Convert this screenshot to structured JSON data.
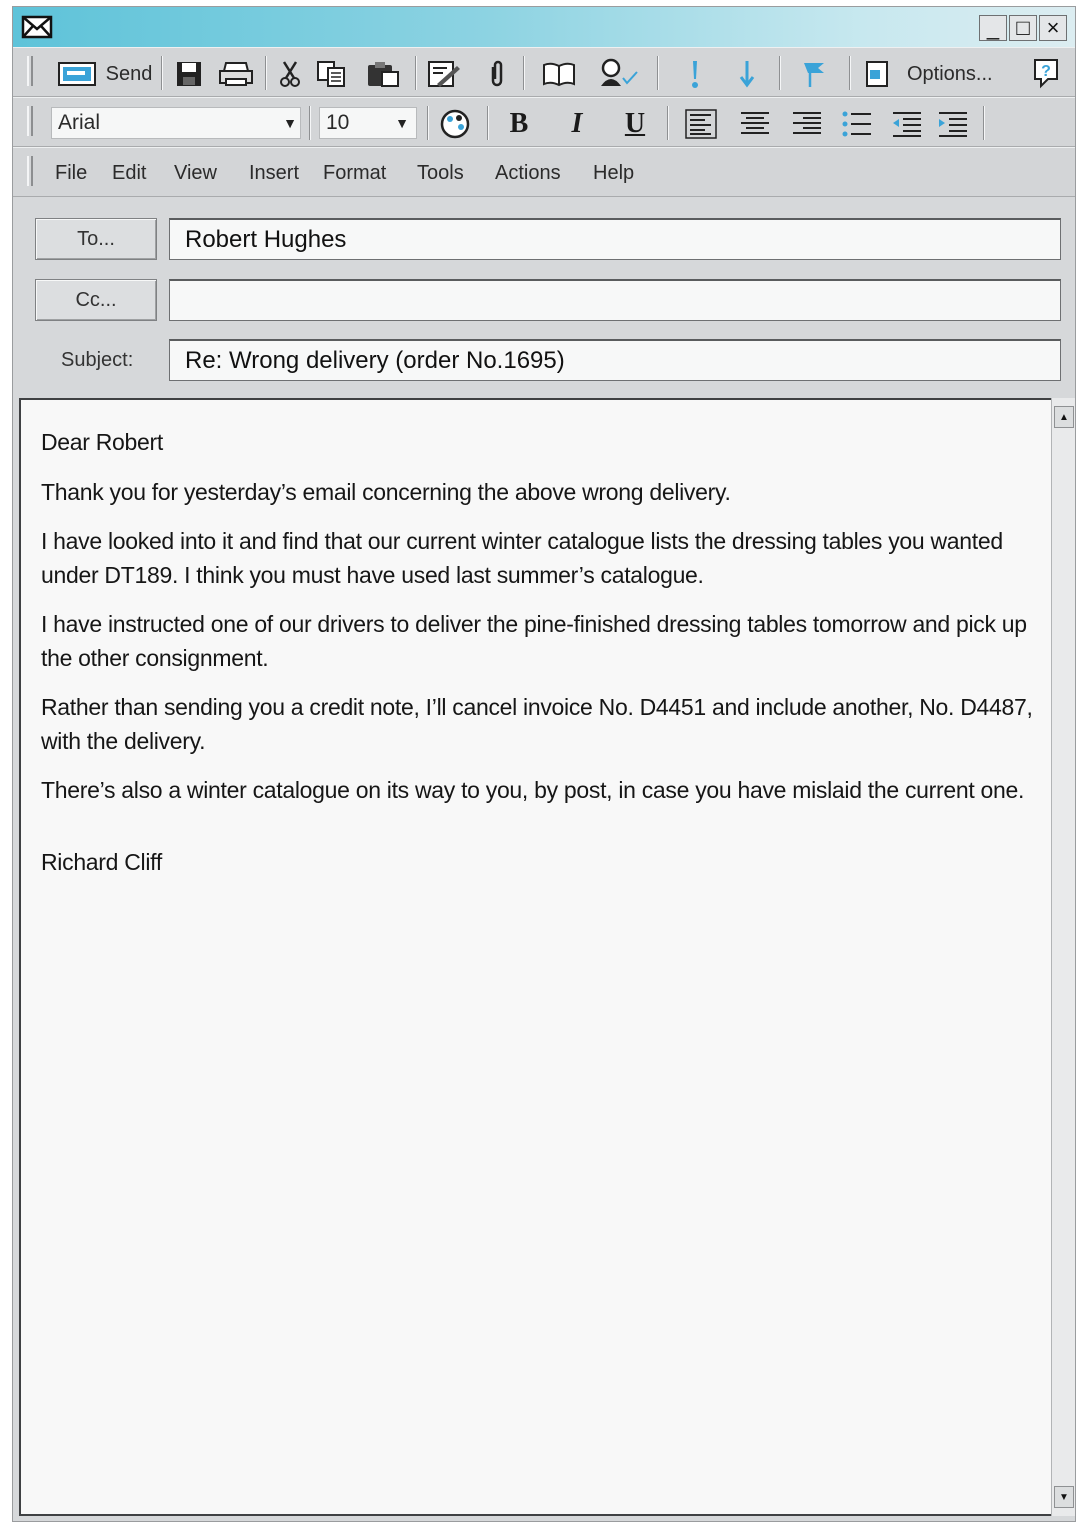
{
  "titlebar": {
    "icon": "envelope-icon",
    "minimize_label": "_",
    "maximize_label": "□",
    "close_label": "×"
  },
  "standard_toolbar": {
    "send_label": "Send",
    "options_label": "Options...",
    "icons": [
      "send-icon",
      "save-icon",
      "print-icon",
      "cut-icon",
      "copy-icon",
      "paste-icon",
      "signature-icon",
      "attach-icon",
      "address-book-icon",
      "check-names-icon",
      "importance-high-icon",
      "importance-low-icon",
      "flag-icon",
      "options-icon",
      "help-icon"
    ]
  },
  "format_toolbar": {
    "font_name": "Arial",
    "font_size": "10",
    "bold_label": "B",
    "italic_label": "I",
    "underline_label": "U"
  },
  "menu": {
    "items": [
      "File",
      "Edit",
      "View",
      "Insert",
      "Format",
      "Tools",
      "Actions",
      "Help"
    ]
  },
  "header": {
    "to_button": "To...",
    "to_value": "Robert Hughes",
    "cc_button": "Cc...",
    "cc_value": "",
    "subject_label": "Subject:",
    "subject_value": "Re: Wrong delivery (order No.1695)"
  },
  "message": {
    "greeting": "Dear Robert",
    "paragraphs": [
      "Thank you for yesterday’s email concerning the above wrong delivery.",
      "I have looked into it and find that our current winter catalogue lists the dressing tables you wanted under DT189. I think you must have used last summer’s catalogue.",
      "I have instructed one of our drivers to deliver the pine-finished dressing tables tomorrow and pick up the other consignment.",
      "Rather than sending you a credit note, I’ll cancel invoice No. D4451 and include another, No. D4487, with the delivery.",
      "There’s also a winter catalogue on its way to you, by post, in case you have mislaid the current one."
    ],
    "signature": "Richard Cliff"
  },
  "colors": {
    "titlebar_start": "#5ec3d9",
    "titlebar_end": "#dcedf1",
    "chrome": "#d6d8da",
    "accent_blue": "#3aa3d8"
  }
}
